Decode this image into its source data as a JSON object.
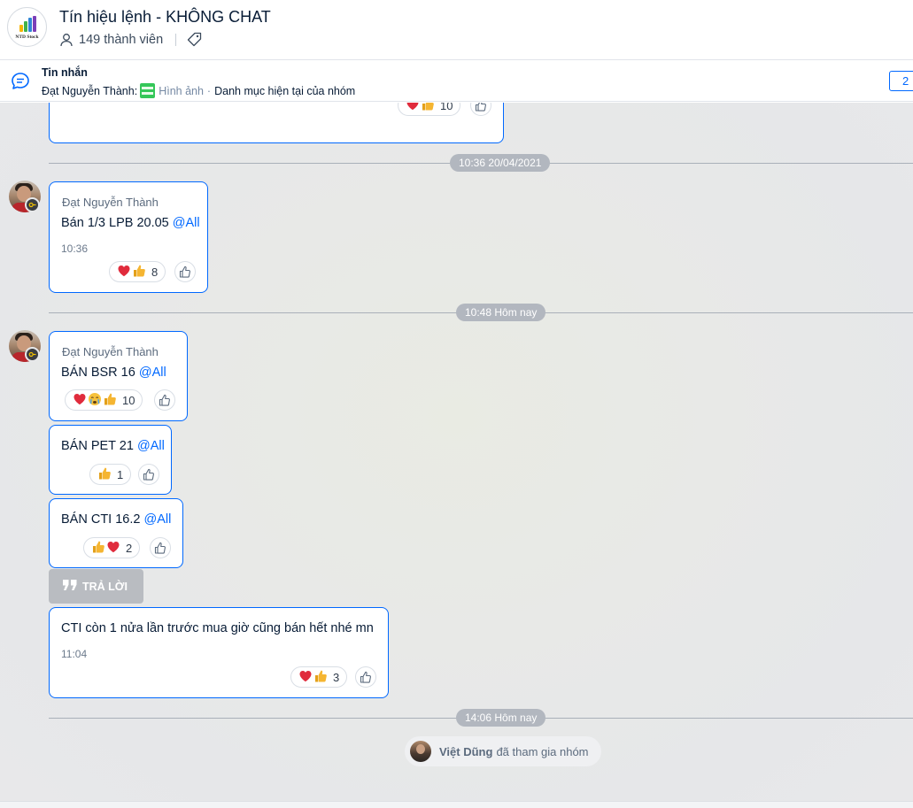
{
  "header": {
    "title": "Tín hiệu lệnh - KHÔNG CHAT",
    "members": "149 thành viên",
    "logo_text": "NTD Stock"
  },
  "pinned": {
    "title": "Tin nhắn",
    "sender": "Đạt Nguyễn Thành:",
    "attachment": "Hình ảnh",
    "caption": "Danh mục hiện tại của nhóm",
    "more_count": "2"
  },
  "dividers": [
    {
      "label": "10:36 20/04/2021"
    },
    {
      "label": "10:48 Hôm nay"
    },
    {
      "label": "14:06 Hôm nay"
    }
  ],
  "messages": [
    {
      "reactions": [
        "heart",
        "thumbs-up"
      ],
      "count": "10"
    },
    {
      "sender": "Đạt Nguyễn Thành",
      "text": "Bán 1/3 LPB 20.05 ",
      "mention": "@All",
      "time": "10:36",
      "reactions": [
        "heart",
        "thumbs-up"
      ],
      "count": "8"
    },
    {
      "sender": "Đạt Nguyễn Thành",
      "text": "BÁN BSR 16 ",
      "mention": "@All",
      "reactions": [
        "heart",
        "crying",
        "thumbs-up"
      ],
      "count": "10"
    },
    {
      "text": "BÁN PET 21 ",
      "mention": "@All",
      "reactions": [
        "thumbs-up"
      ],
      "count": "1"
    },
    {
      "text": "BÁN CTI 16.2 ",
      "mention": "@All",
      "reactions": [
        "thumbs-up",
        "heart"
      ],
      "count": "2"
    },
    {
      "text": "CTI còn 1 nửa lần trước mua giờ cũng bán hết nhé mn",
      "time": "11:04",
      "reactions": [
        "heart",
        "thumbs-up"
      ],
      "count": "3"
    }
  ],
  "reply_button": {
    "label": "TRẢ LỜI"
  },
  "join_notice": {
    "name": "Việt Dũng",
    "text": "đã tham gia nhóm"
  },
  "colors": {
    "accent": "#0068ff",
    "heart": "#e02b3c",
    "thumb": "#f5b531"
  }
}
